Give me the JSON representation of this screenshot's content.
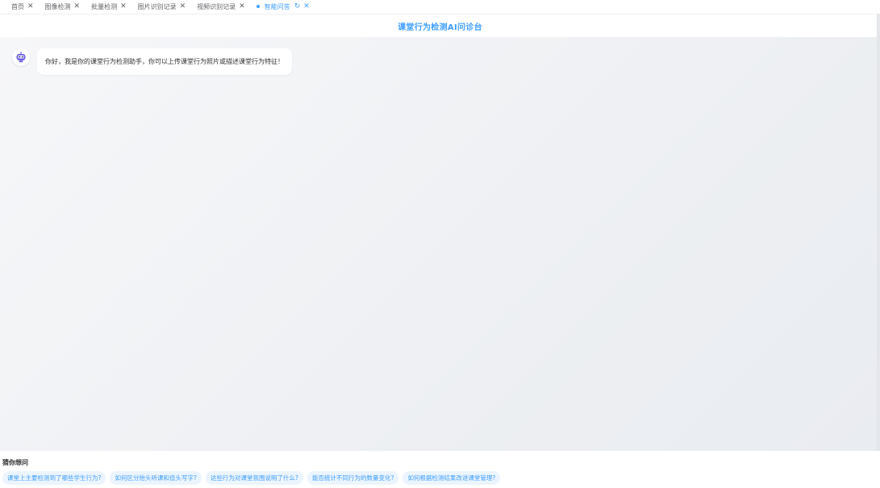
{
  "tabs": [
    {
      "label": "首页",
      "active": false
    },
    {
      "label": "图像检测",
      "active": false
    },
    {
      "label": "批量检测",
      "active": false
    },
    {
      "label": "图片识别记录",
      "active": false
    },
    {
      "label": "视频识别记录",
      "active": false
    },
    {
      "label": "智能问答",
      "active": true
    }
  ],
  "header": {
    "title": "课堂行为检测AI问诊台"
  },
  "chat": {
    "messages": [
      {
        "role": "assistant",
        "text": "你好，我是你的课堂行为检测助手，你可以上传课堂行为照片或描述课堂行为特征！"
      }
    ]
  },
  "suggestions": {
    "title": "猜你想问",
    "items": [
      "课堂上主要检测到了哪些学生行为?",
      "如何区分抬头听课和低头写字?",
      "这些行为对课堂氛围说明了什么?",
      "能否统计不同行为的数量变化?",
      "如何根据检测结果改进课堂管理?"
    ]
  },
  "colors": {
    "accent": "#409eff",
    "chip_bg": "#ecf5ff"
  }
}
